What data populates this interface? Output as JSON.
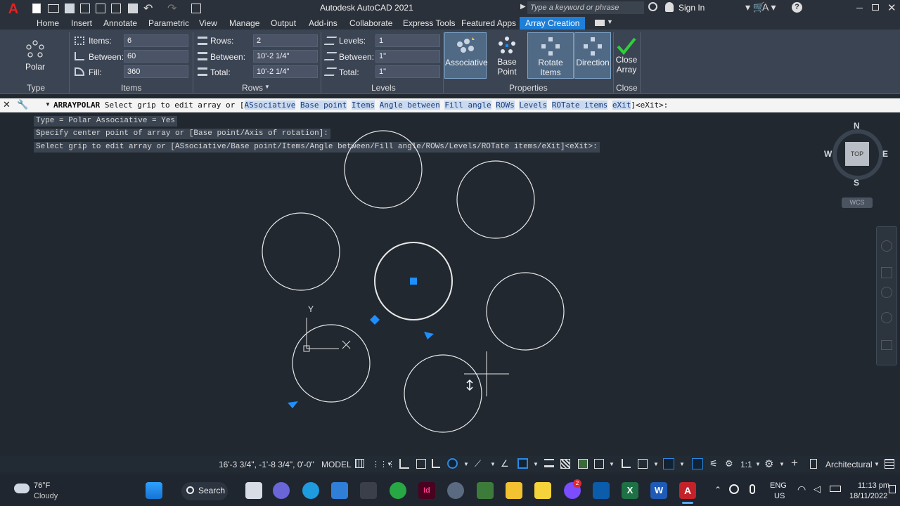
{
  "title": "Autodesk AutoCAD 2021",
  "search": {
    "placeholder": "Type a keyword or phrase"
  },
  "signin": "Sign In",
  "menu_tabs": [
    "Home",
    "Insert",
    "Annotate",
    "Parametric",
    "View",
    "Manage",
    "Output",
    "Add-ins",
    "Collaborate",
    "Express Tools",
    "Featured Apps",
    "Array Creation"
  ],
  "ribbon": {
    "type": {
      "button": "Polar",
      "panel": "Type"
    },
    "items": {
      "panel": "Items",
      "items_label": "Items:",
      "items_value": "6",
      "between_label": "Between:",
      "between_value": "60",
      "fill_label": "Fill:",
      "fill_value": "360"
    },
    "rows": {
      "panel": "Rows",
      "rows_label": "Rows:",
      "rows_value": "2",
      "between_label": "Between:",
      "between_value": "10'-2 1/4\"",
      "total_label": "Total:",
      "total_value": "10'-2 1/4\""
    },
    "levels": {
      "panel": "Levels",
      "levels_label": "Levels:",
      "levels_value": "1",
      "between_label": "Between:",
      "between_value": "1\"",
      "total_label": "Total:",
      "total_value": "1\""
    },
    "properties": {
      "panel": "Properties",
      "associative": "Associative",
      "base_point": "Base Point",
      "rotate_items": "Rotate Items",
      "direction": "Direction"
    },
    "close": {
      "panel": "Close",
      "label_1": "Close",
      "label_2": "Array"
    }
  },
  "command": {
    "name": "ARRAYPOLAR",
    "prompt": "Select grip to edit array or [",
    "options": [
      "ASsociative",
      "Base point",
      "Items",
      "Angle between",
      "Fill angle",
      "ROWs",
      "Levels",
      "ROTate items",
      "eXit"
    ],
    "suffix": "]<eXit>:"
  },
  "history": [
    "Type = Polar  Associative = Yes",
    "Specify center point of array or [Base point/Axis of rotation]:",
    "Select grip to edit array or [ASsociative/Base point/Items/Angle between/Fill angle/ROWs/Levels/ROTate items/eXit]<eXit>:"
  ],
  "viewcube": {
    "n": "N",
    "s": "S",
    "e": "E",
    "w": "W",
    "face": "TOP",
    "wcs": "WCS"
  },
  "ucs": {
    "y": "Y"
  },
  "status": {
    "coords": "16'-3 3/4\", -1'-8 3/4\", 0'-0\"",
    "model": "MODEL",
    "scale": "1:1",
    "units": "Architectural"
  },
  "taskbar": {
    "temp": "76°F",
    "weather": "Cloudy",
    "search": "Search",
    "lang_1": "ENG",
    "lang_2": "US",
    "time": "11:13 pm",
    "date": "18/11/2022",
    "badge": "2"
  },
  "colors": {
    "accent": "#1e7fd9",
    "ribbon": "#3b4453",
    "canvas": "#212830",
    "grip": "#1e8fff"
  }
}
